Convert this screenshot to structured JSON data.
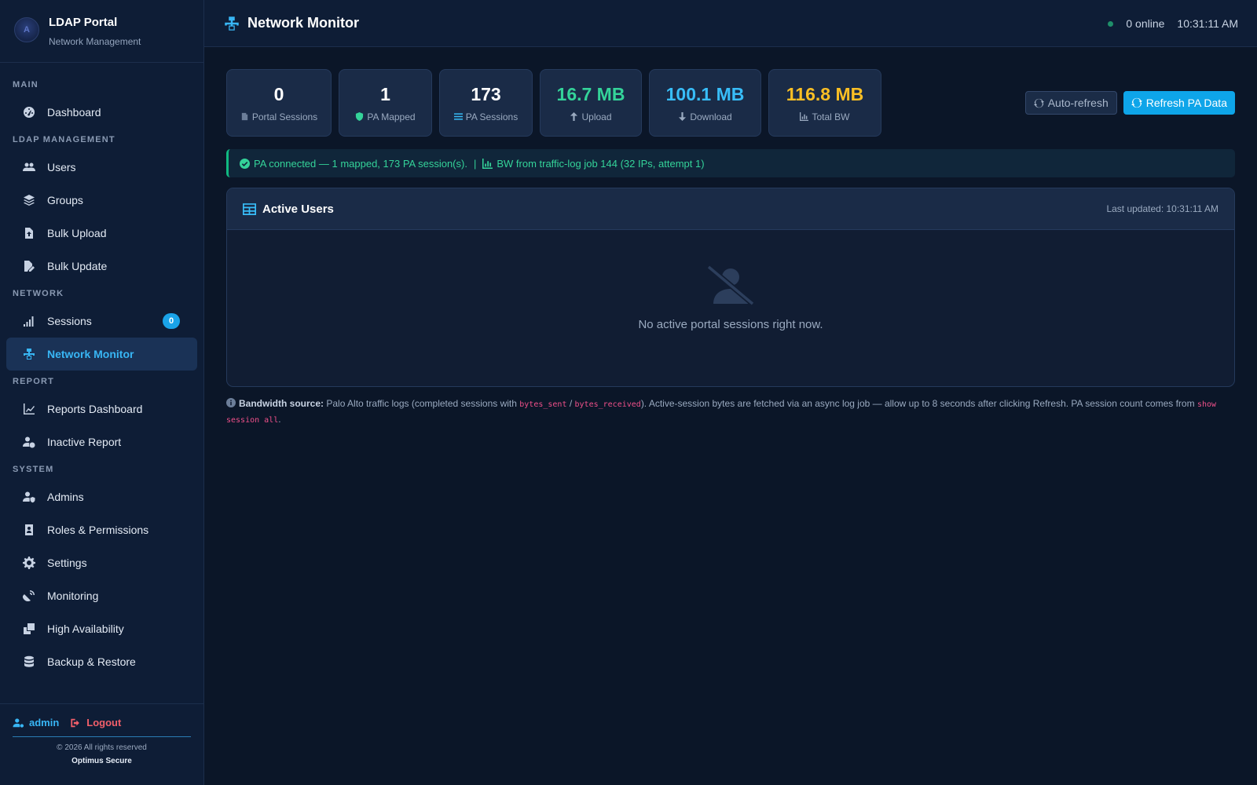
{
  "brand": {
    "title": "LDAP Portal",
    "subtitle": "Network Management",
    "logo_text": "A"
  },
  "nav": {
    "sections": {
      "main": "MAIN",
      "ldap": "LDAP MANAGEMENT",
      "network": "NETWORK",
      "report": "REPORT",
      "system": "SYSTEM"
    },
    "items": {
      "dashboard": "Dashboard",
      "users": "Users",
      "groups": "Groups",
      "bulk_upload": "Bulk Upload",
      "bulk_update": "Bulk Update",
      "sessions": "Sessions",
      "sessions_badge": "0",
      "network_monitor": "Network Monitor",
      "reports_dashboard": "Reports Dashboard",
      "inactive_report": "Inactive Report",
      "admins": "Admins",
      "roles": "Roles & Permissions",
      "settings": "Settings",
      "monitoring": "Monitoring",
      "high_availability": "High Availability",
      "backup_restore": "Backup & Restore"
    },
    "active": "network_monitor"
  },
  "footer": {
    "user": "admin",
    "logout": "Logout",
    "copyright": "© 2026 All rights reserved",
    "company": "Optimus Secure"
  },
  "header": {
    "title": "Network Monitor",
    "online": "0 online",
    "time": "10:31:11 AM"
  },
  "stats": [
    {
      "value": "0",
      "label": "Portal Sessions",
      "icon": "door-icon"
    },
    {
      "value": "1",
      "label": "PA Mapped",
      "icon": "shield-icon"
    },
    {
      "value": "173",
      "label": "PA Sessions",
      "icon": "list-icon"
    },
    {
      "value": "16.7 MB",
      "label": "Upload",
      "icon": "arrow-up-icon"
    },
    {
      "value": "100.1 MB",
      "label": "Download",
      "icon": "arrow-down-icon"
    },
    {
      "value": "116.8 MB",
      "label": "Total BW",
      "icon": "chart-icon"
    }
  ],
  "actions": {
    "auto_refresh": "Auto-refresh",
    "refresh": "Refresh PA Data"
  },
  "status": {
    "connected": "PA connected — 1 mapped, 173 PA session(s).",
    "separator": "|",
    "bandwidth": "BW from traffic-log job 144 (32 IPs, attempt 1)"
  },
  "active_users": {
    "title": "Active Users",
    "updated": "Last updated: 10:31:11 AM",
    "empty": "No active portal sessions right now."
  },
  "note": {
    "label": "Bandwidth source:",
    "text1": "Palo Alto traffic logs (completed sessions with",
    "code1": "bytes_sent",
    "slash": "/",
    "code2": "bytes_received",
    "text2": "). Active-session bytes are fetched via an async log job — allow up to 8 seconds after clicking Refresh. PA session count comes from",
    "code3": "show session all",
    "end": "."
  },
  "colors": {
    "accent": "#38b6f5",
    "success": "#34d399",
    "upload": "#34d399",
    "download": "#38bdf8",
    "total": "#fbbf24",
    "danger": "#f25f6a"
  }
}
